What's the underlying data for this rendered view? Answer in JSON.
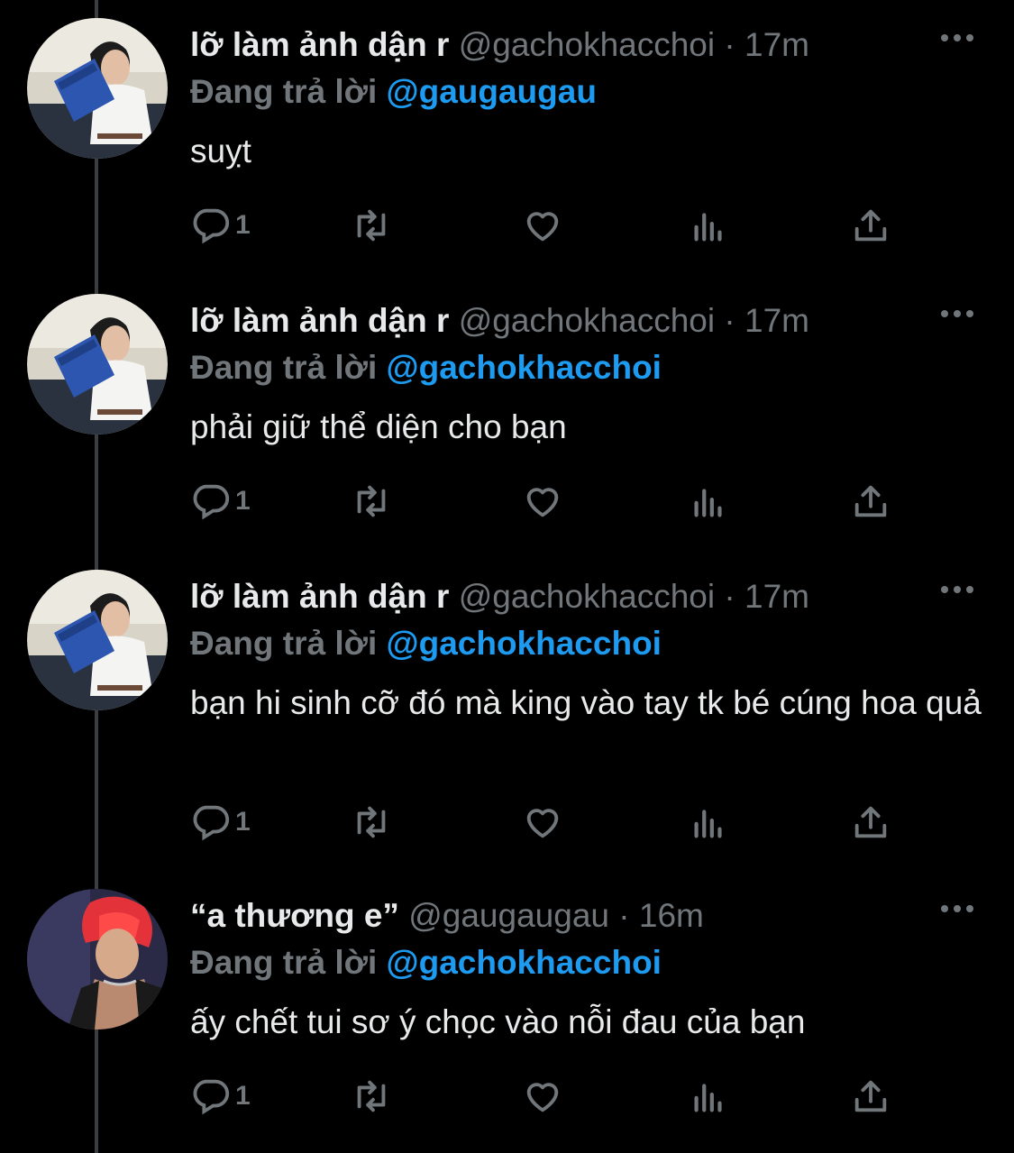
{
  "tweets": [
    {
      "name": "lỡ làm ảnh dận r",
      "handle": "@gachokhacchoi",
      "sep": "·",
      "time": "17m",
      "reply_prefix": "Đang trả lời",
      "reply_to": "@gaugaugau",
      "text": "suỵt",
      "reply_count": "1",
      "avatar": "guy-reading-blue-book"
    },
    {
      "name": "lỡ làm ảnh dận r",
      "handle": "@gachokhacchoi",
      "sep": "·",
      "time": "17m",
      "reply_prefix": "Đang trả lời",
      "reply_to": "@gachokhacchoi",
      "text": "phải giữ thể diện cho bạn",
      "reply_count": "1",
      "avatar": "guy-reading-blue-book"
    },
    {
      "name": "lỡ làm ảnh dận r",
      "handle": "@gachokhacchoi",
      "sep": "·",
      "time": "17m",
      "reply_prefix": "Đang trả lời",
      "reply_to": "@gachokhacchoi",
      "text": "bạn hi sinh cỡ đó mà king vào tay tk bé cúng hoa quả",
      "reply_count": "1",
      "avatar": "guy-reading-blue-book"
    },
    {
      "name": "“a thương e”",
      "handle": "@gaugaugau",
      "sep": "·",
      "time": "16m",
      "reply_prefix": "Đang trả lời",
      "reply_to": "@gachokhacchoi",
      "text": "ấy chết tui sơ ý chọc vào nỗi đau của bạn",
      "reply_count": "1",
      "avatar": "red-hair-performer"
    }
  ],
  "colors": {
    "background": "#000000",
    "text": "#e7e9ea",
    "muted": "#71767b",
    "link": "#1d9bf0",
    "thread_line": "#3a3d41"
  },
  "icons": [
    "reply-icon",
    "retweet-icon",
    "like-icon",
    "views-icon",
    "share-icon",
    "more-icon"
  ]
}
